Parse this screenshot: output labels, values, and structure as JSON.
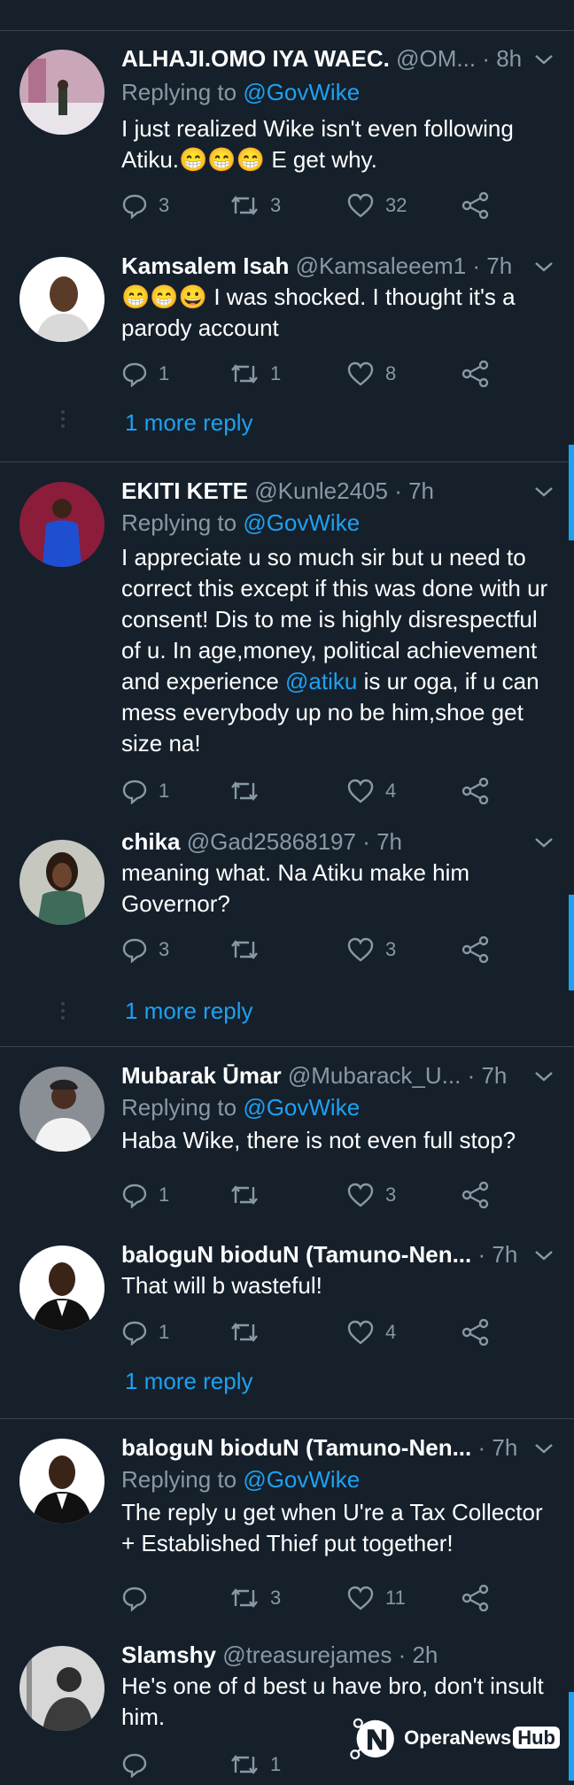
{
  "colors": {
    "background": "#15202b",
    "accent": "#1da1f2",
    "muted": "#8899a6",
    "divider": "#38444d"
  },
  "tweets": [
    {
      "name": "ALHAJI.OMO IYA WAEC.",
      "handle": "@OM...",
      "time": "· 8h",
      "replying_prefix": "Replying to ",
      "replying_handle": "@GovWike",
      "body": "I just realized Wike isn't even following Atiku.😁😁😁 E get why.",
      "replies": "3",
      "retweets": "3",
      "likes": "32"
    },
    {
      "name": "Kamsalem Isah",
      "handle": "@Kamsaleeem1",
      "time": "· 7h",
      "body": "😁😁😀 I was shocked. I thought it's a parody account",
      "replies": "1",
      "retweets": "1",
      "likes": "8",
      "more_reply": "1 more reply"
    },
    {
      "name": "EKITI KETE",
      "handle": "@Kunle2405",
      "time": "· 7h",
      "replying_prefix": "Replying to ",
      "replying_handle": "@GovWike",
      "body_before": "I appreciate u so much sir but u need to correct this except if this was done with ur consent! Dis to me is highly disrespectful of u. In age,money, political achievement and experience ",
      "body_link": "@atiku",
      "body_after": " is ur oga, if u can mess everybody up no be him,shoe get size na!",
      "replies": "1",
      "retweets": "",
      "likes": "4"
    },
    {
      "name": "chika",
      "handle": "@Gad25868197",
      "time": "· 7h",
      "body": "meaning what. Na Atiku make him Governor?",
      "replies": "3",
      "retweets": "",
      "likes": "3",
      "more_reply": "1 more reply"
    },
    {
      "name": "Mubarak Ūmar",
      "handle": "@Mubarack_U...",
      "time": "· 7h",
      "replying_prefix": "Replying to ",
      "replying_handle": "@GovWike",
      "body": "Haba Wike, there is not even full stop?",
      "replies": "1",
      "retweets": "",
      "likes": "3"
    },
    {
      "name": "baloguN bioduN (Tamuno-Nen...",
      "time": "· 7h",
      "body": "That will b wasteful!",
      "replies": "1",
      "retweets": "",
      "likes": "4",
      "more_reply": "1 more reply"
    },
    {
      "name": "baloguN bioduN (Tamuno-Nen...",
      "time": "· 7h",
      "replying_prefix": "Replying to ",
      "replying_handle": "@GovWike",
      "body": "The reply u get when U're a Tax Collector + Established Thief put together!",
      "replies": "",
      "retweets": "3",
      "likes": "11"
    },
    {
      "name": "Slamshy",
      "handle": "@treasurejames",
      "time": "· 2h",
      "body": "He's one of d best u have bro, don't insult him.",
      "replies": "",
      "retweets": "1",
      "likes": ""
    }
  ],
  "watermark": {
    "brand": "OperaNews",
    "hub": "Hub"
  }
}
